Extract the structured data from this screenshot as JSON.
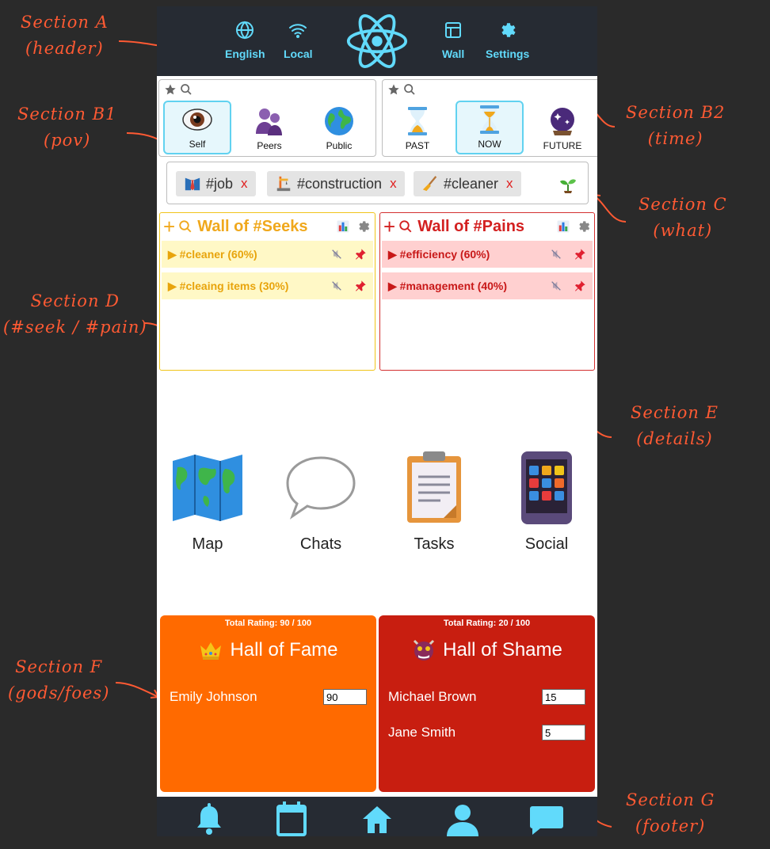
{
  "annotations": {
    "a": [
      "Section A",
      "(header)"
    ],
    "b1": [
      "Section B1",
      "(pov)"
    ],
    "b2": [
      "Section B2",
      "(time)"
    ],
    "c": [
      "Section C",
      "(what)"
    ],
    "d": [
      "Section D",
      "(#seek / #pain)"
    ],
    "e": [
      "Section E",
      "(details)"
    ],
    "f": [
      "Section F",
      "(gods/foes)"
    ],
    "g": [
      "Section G",
      "(footer)"
    ]
  },
  "header": {
    "language": "English",
    "network": "Local",
    "wall": "Wall",
    "settings": "Settings",
    "accent": "#61dafb",
    "background": "#262b33"
  },
  "pov": {
    "options": [
      {
        "label": "Self",
        "icon": "eye-icon",
        "selected": true
      },
      {
        "label": "Peers",
        "icon": "people-icon",
        "selected": false
      },
      {
        "label": "Public",
        "icon": "globe-icon",
        "selected": false
      }
    ]
  },
  "time": {
    "options": [
      {
        "label": "PAST",
        "icon": "hourglass-done-icon",
        "selected": false
      },
      {
        "label": "NOW",
        "icon": "hourglass-flowing-icon",
        "selected": true
      },
      {
        "label": "FUTURE",
        "icon": "crystal-ball-icon",
        "selected": false
      }
    ]
  },
  "tags": [
    {
      "label": "#job",
      "icon": "necktie-icon",
      "remove": "x"
    },
    {
      "label": "#construction",
      "icon": "construction-icon",
      "remove": "x"
    },
    {
      "label": "#cleaner",
      "icon": "broom-icon",
      "remove": "x"
    }
  ],
  "seeks": {
    "plus": "+",
    "title": "Wall of #Seeks",
    "items": [
      {
        "label": "▶ #cleaner (60%)"
      },
      {
        "label": "▶ #cleaing items (30%)"
      }
    ]
  },
  "pains": {
    "plus": "+",
    "title": "Wall of #Pains",
    "items": [
      {
        "label": "▶ #efficiency (60%)"
      },
      {
        "label": "▶ #management (40%)"
      }
    ]
  },
  "apps": [
    {
      "label": "Map",
      "icon": "map-icon"
    },
    {
      "label": "Chats",
      "icon": "speech-bubble-icon"
    },
    {
      "label": "Tasks",
      "icon": "clipboard-icon"
    },
    {
      "label": "Social",
      "icon": "app-grid-icon"
    }
  ],
  "fame": {
    "rating": "Total Rating: 90 / 100",
    "title": "Hall of Fame",
    "people": [
      {
        "name": "Emily Johnson",
        "score": "90"
      }
    ],
    "color": "#ff6a00"
  },
  "shame": {
    "rating": "Total Rating: 20 / 100",
    "title": "Hall of Shame",
    "people": [
      {
        "name": "Michael Brown",
        "score": "15"
      },
      {
        "name": "Jane Smith",
        "score": "5"
      }
    ],
    "color": "#c81e10"
  },
  "footer": {
    "icons": [
      "bell-icon",
      "calendar-icon",
      "home-icon",
      "user-icon",
      "chat-icon"
    ]
  }
}
